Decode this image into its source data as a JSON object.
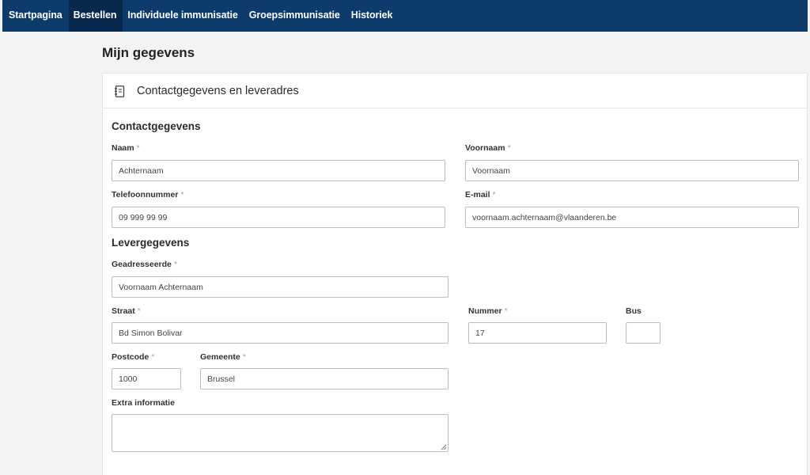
{
  "nav": {
    "items": [
      {
        "label": "Startpagina"
      },
      {
        "label": "Bestellen"
      },
      {
        "label": "Individuele immunisatie"
      },
      {
        "label": "Groepsimmunisatie"
      },
      {
        "label": "Historiek"
      }
    ],
    "active_index": 1,
    "background": "#0c3b6c",
    "active_background": "#07294d"
  },
  "page": {
    "title": "Mijn gegevens"
  },
  "panel": {
    "title": "Contactgegevens en leveradres",
    "icon": "document-icon"
  },
  "contact": {
    "section_title": "Contactgegevens",
    "naam": {
      "label": "Naam",
      "value": "Achternaam"
    },
    "voornaam": {
      "label": "Voornaam",
      "value": "Voornaam"
    },
    "telefoon": {
      "label": "Telefoonnummer",
      "value": "09 999 99 99"
    },
    "email": {
      "label": "E-mail",
      "value": "voornaam.achternaam@vlaanderen.be"
    }
  },
  "levering": {
    "section_title": "Levergegevens",
    "geadresseerde": {
      "label": "Geadresseerde",
      "value": "Voornaam Achternaam"
    },
    "straat": {
      "label": "Straat",
      "value": "Bd Simon Bolivar"
    },
    "nummer": {
      "label": "Nummer",
      "value": "17"
    },
    "bus": {
      "label": "Bus",
      "value": ""
    },
    "postcode": {
      "label": "Postcode",
      "value": "1000"
    },
    "gemeente": {
      "label": "Gemeente",
      "value": "Brussel"
    },
    "extra": {
      "label": "Extra informatie",
      "value": ""
    }
  },
  "required_marker": "*"
}
